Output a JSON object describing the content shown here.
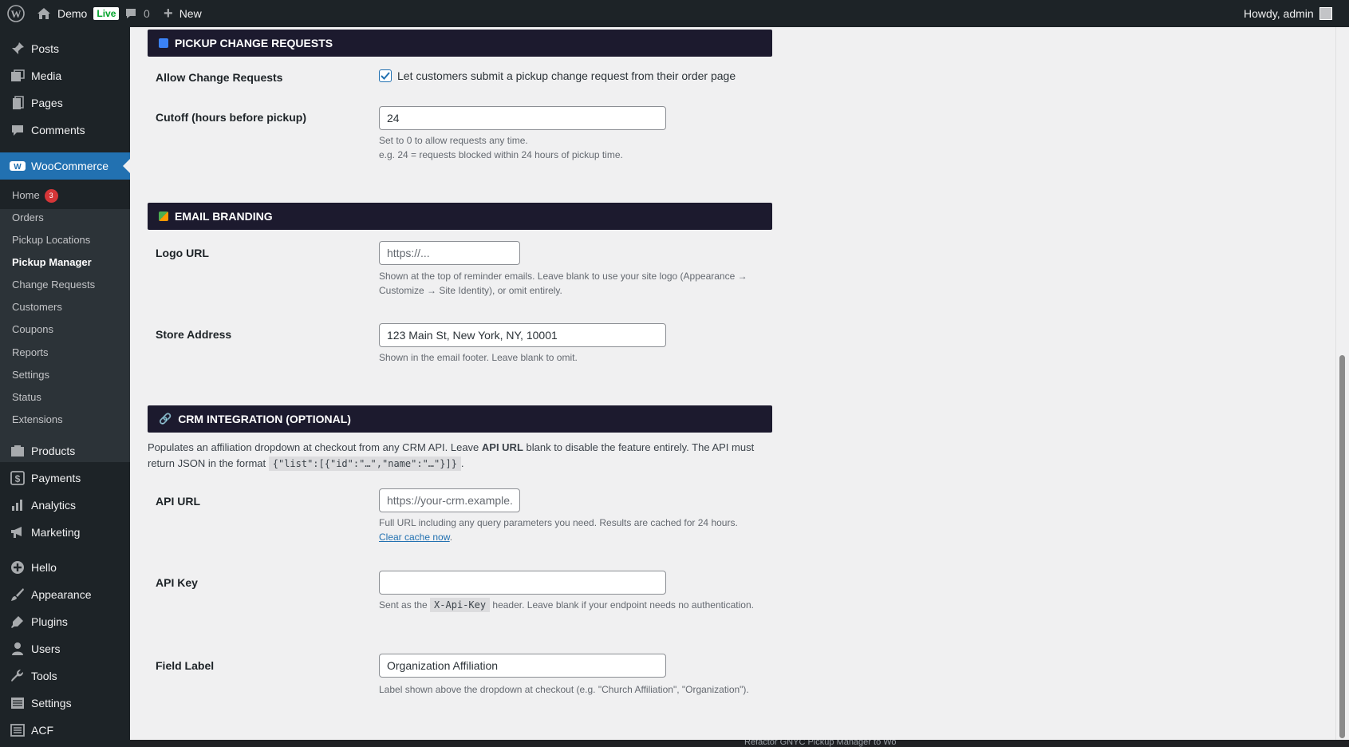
{
  "adminbar": {
    "site": "Demo",
    "live": "Live",
    "comments": "0",
    "new": "New",
    "howdy": "Howdy, admin"
  },
  "sidebar": {
    "posts": "Posts",
    "media": "Media",
    "pages": "Pages",
    "comments": "Comments",
    "woocommerce": "WooCommerce",
    "sub": [
      "Home",
      "Orders",
      "Pickup Locations",
      "Pickup Manager",
      "Change Requests",
      "Customers",
      "Coupons",
      "Reports",
      "Settings",
      "Status",
      "Extensions"
    ],
    "home_badge": "3",
    "products": "Products",
    "payments": "Payments",
    "analytics": "Analytics",
    "marketing": "Marketing",
    "hello": "Hello",
    "appearance": "Appearance",
    "plugins": "Plugins",
    "users": "Users",
    "tools": "Tools",
    "settings": "Settings",
    "acf": "ACF"
  },
  "pickup_changes": {
    "title": "PICKUP CHANGE REQUESTS",
    "allow_label": "Allow Change Requests",
    "allow_checked": true,
    "allow_text": "Let customers submit a pickup change request from their order page",
    "cutoff_label": "Cutoff (hours before pickup)",
    "cutoff_value": "24",
    "cutoff_desc1": "Set to 0 to allow requests any time.",
    "cutoff_desc2": "e.g. 24 = requests blocked within 24 hours of pickup time."
  },
  "email_branding": {
    "title": "EMAIL BRANDING",
    "logo_label": "Logo URL",
    "logo_placeholder": "https://...",
    "logo_desc": "Shown at the top of reminder emails. Leave blank to use your site logo (Appearance → Customize → Site Identity), or omit entirely.",
    "address_label": "Store Address",
    "address_value": "123 Main St, New York, NY, 10001",
    "address_desc": "Shown in the email footer. Leave blank to omit."
  },
  "crm": {
    "title": "CRM INTEGRATION (OPTIONAL)",
    "intro_a": "Populates an affiliation dropdown at checkout from any CRM API. Leave ",
    "intro_b": "API URL",
    "intro_c": " blank to disable the feature entirely. The API must return JSON in the format ",
    "intro_code": "{\"list\":[{\"id\":\"…\",\"name\":\"…\"}]}",
    "intro_d": ".",
    "api_url_label": "API URL",
    "api_url_placeholder": "https://your-crm.example.",
    "api_url_desc": "Full URL including any query parameters you need. Results are cached for 24 hours.",
    "clear_cache": "Clear cache now",
    "api_key_label": "API Key",
    "api_key_value": "",
    "api_key_desc_a": "Sent as the ",
    "api_key_code": "X-Api-Key",
    "api_key_desc_b": " header. Leave blank if your endpoint needs no authentication.",
    "field_label_label": "Field Label",
    "field_label_value": "Organization Affiliation",
    "field_label_desc": "Label shown above the dropdown at checkout (e.g. \"Church Affiliation\", \"Organization\")."
  },
  "taskbar": {
    "text": "Refactor GNYC Pickup Manager to Wo"
  },
  "colors": {
    "accent": "#2271b1",
    "section_header": "#1c1a2e",
    "admin_bg": "#1d2327",
    "badge": "#d63638"
  }
}
